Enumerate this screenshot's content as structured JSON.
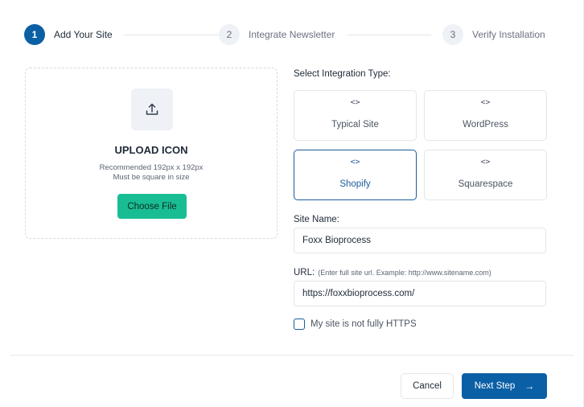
{
  "stepper": {
    "steps": [
      {
        "number": "1",
        "label": "Add Your Site",
        "active": true
      },
      {
        "number": "2",
        "label": "Integrate Newsletter",
        "active": false
      },
      {
        "number": "3",
        "label": "Verify Installation",
        "active": false
      }
    ]
  },
  "upload": {
    "icon": "upload-icon",
    "title": "UPLOAD ICON",
    "recommended": "Recommended 192px x 192px",
    "square_note": "Must be square in size",
    "choose_label": "Choose File"
  },
  "integration": {
    "label": "Select Integration Type:",
    "icon": "code-icon",
    "icon_glyph": "<>",
    "options": [
      {
        "name": "Typical Site",
        "selected": false
      },
      {
        "name": "WordPress",
        "selected": false
      },
      {
        "name": "Shopify",
        "selected": true
      },
      {
        "name": "Squarespace",
        "selected": false
      }
    ]
  },
  "site_name": {
    "label": "Site Name:",
    "value": "Foxx Bioprocess"
  },
  "url": {
    "label": "URL:",
    "hint": "(Enter full site url. Example: http://www.sitename.com)",
    "value": "https://foxxbioprocess.com/"
  },
  "https_check": {
    "label": "My site is not fully HTTPS",
    "checked": false
  },
  "footer": {
    "cancel_label": "Cancel",
    "next_label": "Next Step",
    "next_icon": "arrow-right-icon",
    "next_glyph": "→"
  },
  "colors": {
    "primary": "#0b5fa5",
    "accent_green": "#19bd93",
    "border": "#e3e6eb"
  }
}
